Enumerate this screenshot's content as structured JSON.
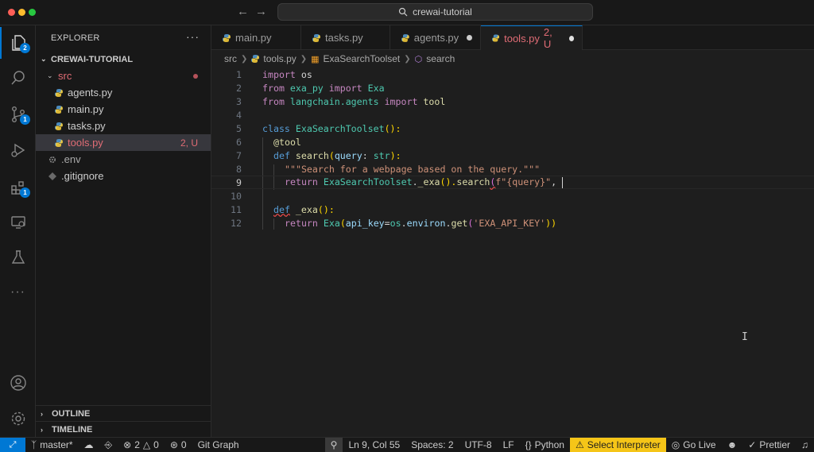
{
  "window": {
    "title": "crewai-tutorial"
  },
  "activity": {
    "explorer_badge": "2",
    "scm_badge": "1",
    "extensions_badge": "1"
  },
  "sidebar": {
    "title": "EXPLORER",
    "more": "···",
    "root": "CREWAI-TUTORIAL",
    "folder": "src",
    "files": [
      {
        "name": "agents.py"
      },
      {
        "name": "main.py"
      },
      {
        "name": "tasks.py"
      },
      {
        "name": "tools.py",
        "decoration": "2, U"
      }
    ],
    "root_files": [
      {
        "name": ".env"
      },
      {
        "name": ".gitignore"
      }
    ],
    "outline": "OUTLINE",
    "timeline": "TIMELINE"
  },
  "tabs": [
    {
      "label": "main.py"
    },
    {
      "label": "tasks.py"
    },
    {
      "label": "agents.py"
    },
    {
      "label": "tools.py",
      "badge": "2, U"
    }
  ],
  "breadcrumb": {
    "folder": "src",
    "file": "tools.py",
    "class": "ExaSearchToolset",
    "method": "search"
  },
  "editor": {
    "line_numbers": [
      "1",
      "2",
      "3",
      "4",
      "5",
      "6",
      "7",
      "8",
      "9",
      "10",
      "11",
      "12"
    ],
    "current_line": "9",
    "lines": {
      "l1": [
        "import",
        " os"
      ],
      "l2": [
        "from",
        " exa_py ",
        "import",
        " Exa"
      ],
      "l3": [
        "from",
        " langchain.agents ",
        "import",
        " tool"
      ],
      "l5": [
        "class",
        " ExaSearchToolset",
        "():"
      ],
      "l6": "@tool",
      "l7": [
        "def",
        " search",
        "(",
        "query",
        ": ",
        "str",
        "):"
      ],
      "l8": "\"\"\"Search for a webpage based on the query.\"\"\"",
      "l9": [
        "return",
        " ExaSearchToolset",
        ".",
        "_exa",
        "().",
        "search",
        "(",
        "f\"{query}\"",
        ", "
      ],
      "l11": [
        "def",
        " _exa",
        "():"
      ],
      "l12": [
        "return",
        " Exa",
        "(",
        "api_key",
        "=",
        "os",
        ".",
        "environ",
        ".",
        "get",
        "(",
        "'EXA_API_KEY'",
        "))"
      ]
    }
  },
  "statusbar": {
    "branch": "master*",
    "errors": "2",
    "warnings": "0",
    "ports": "0",
    "git_graph": "Git Graph",
    "position": "Ln 9, Col 55",
    "spaces": "Spaces: 2",
    "encoding": "UTF-8",
    "eol": "LF",
    "language": "Python",
    "interpreter": "Select Interpreter",
    "go_live": "Go Live",
    "prettier": "Prettier"
  }
}
